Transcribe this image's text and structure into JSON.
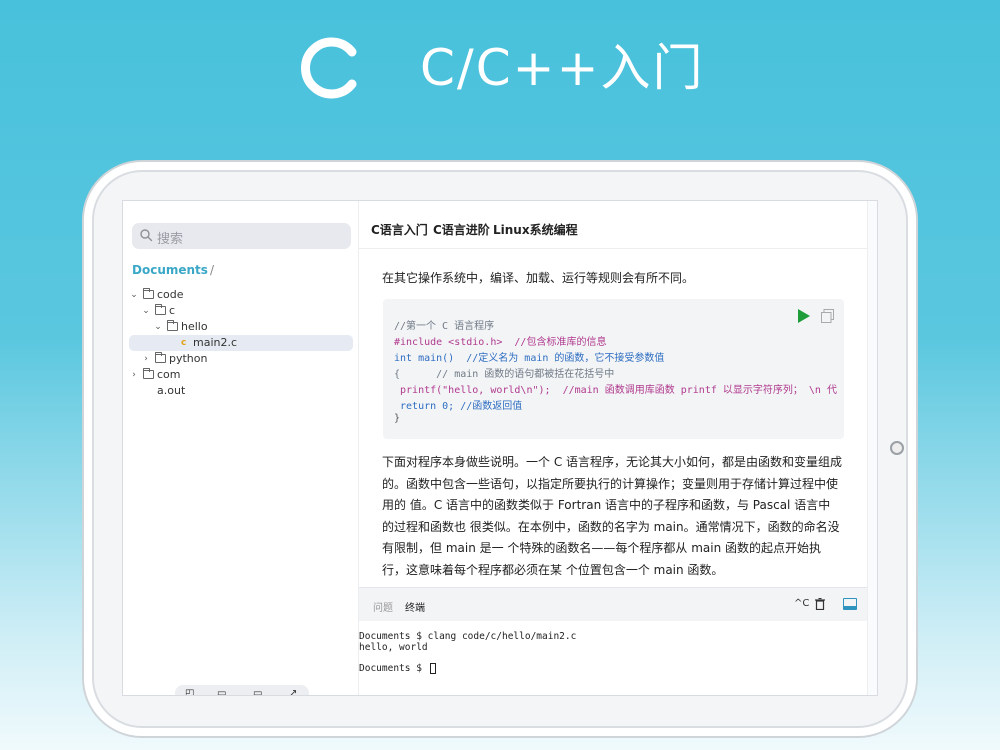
{
  "hero": {
    "logo_letter": "C",
    "title": "C/C++入门"
  },
  "sidebar": {
    "search_placeholder": "搜索",
    "breadcrumb": "Documents",
    "breadcrumb_sep": "/",
    "tree": [
      {
        "label": "code",
        "level": 0,
        "type": "folder",
        "expanded": true
      },
      {
        "label": "c",
        "level": 1,
        "type": "folder",
        "expanded": true
      },
      {
        "label": "hello",
        "level": 2,
        "type": "folder",
        "expanded": true
      },
      {
        "label": "main2.c",
        "level": 3,
        "type": "c-file",
        "selected": true
      },
      {
        "label": "python",
        "level": 1,
        "type": "folder",
        "expanded": false
      },
      {
        "label": "com",
        "level": 0,
        "type": "folder",
        "expanded": false
      },
      {
        "label": "a.out",
        "level": 0,
        "type": "file"
      }
    ]
  },
  "tabs": [
    "C语言入门",
    "C语言进阶",
    "Linux系统编程"
  ],
  "content": {
    "para1": "在其它操作系统中，编译、加载、运行等规则会有所不同。",
    "code_lines": [
      "//第一个 C 语言程序",
      "#include <stdio.h>  //包含标准库的信息",
      "int main()  //定义名为 main 的函数，它不接受参数值",
      "{      // main 函数的语句都被括在花括号中",
      " printf(\"hello, world\\n\");  //main 函数调用库函数 printf 以显示字符序列； \\n 代",
      " return 0; //函数返回值",
      "}"
    ],
    "para2": "下面对程序本身做些说明。一个 C 语言程序，无论其大小如何，都是由函数和变量组成的。函数中包含一些语句，以指定所要执行的计算操作；变量则用于存储计算过程中使用的 值。C 语言中的函数类似于 Fortran 语言中的子程序和函数，与 Pascal 语言中的过程和函数也 很类似。在本例中，函数的名字为 main。通常情况下，函数的命名没有限制，但 main 是一 个特殊的函数名——每个程序都从 main 函数的起点开始执行，这意味着每个程序都必须在某 个位置包含一个 main 函数。"
  },
  "panel": {
    "tabs": [
      "问题",
      "终端"
    ],
    "active_tab": "终端",
    "interrupt_label": "^C"
  },
  "terminal": {
    "lines": [
      "Documents $ clang code/c/hello/main2.c",
      "hello, world",
      "",
      "Documents $ "
    ]
  },
  "colors": {
    "accent": "#3aa7c7",
    "background": "#48c1dc"
  }
}
